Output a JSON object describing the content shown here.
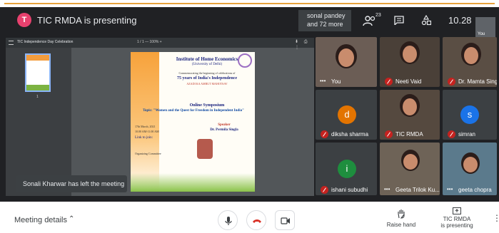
{
  "top_bar": {
    "presenter_initial": "T",
    "presenting_title": "TIC RMDA is presenting",
    "viewers_line1": "sonal pandey",
    "viewers_line2": "and 72 more",
    "people_count": "23",
    "clock": "10.28",
    "self_label": "You"
  },
  "pdf": {
    "title": "TIC Independence Day Celebration",
    "page_nav": "1 / 1   —  100%  +",
    "thumb_number": "1"
  },
  "poster": {
    "institute": "Institute of Home Economics",
    "university": "(University of Delhi)",
    "line_a": "Commemorating the beginning of celebrations of",
    "line_b": "75 years of India's Independence",
    "line_c": "AZADI KA AMRUT MAHOTSAV",
    "line_d": "Online Symposium",
    "topic": "Topic: \"Women and the Quest for Freedom in Independent India\"",
    "speaker_label": "Speaker",
    "speaker_name": "Dr. Permila Singla",
    "date": "17th March, 2021",
    "time": "10.00 AM-11.00 AM",
    "join": "Link to join:",
    "organizing": "Organizing Committee"
  },
  "toast": "Sonali Kharwar has left the meeting",
  "participants": {
    "you": "You",
    "neeti": "Neeti Vaid",
    "mamta": "Dr. Mamta Singh",
    "diksha": "diksha sharma",
    "diksha_initial": "d",
    "tic": "TIC RMDA",
    "simran": "simran",
    "simran_initial": "s",
    "ishani": "ishani subudhi",
    "ishani_initial": "i",
    "geeta_k": "Geeta Trilok Ku...",
    "geeta_c": "geeta chopra"
  },
  "bottom_bar": {
    "meeting_details": "Meeting details",
    "raise_hand": "Raise hand",
    "present_line1": "TIC RMDA",
    "present_line2": "is presenting"
  },
  "colors": {
    "background": "#202124",
    "mute_red": "#c5221f",
    "diksha_avatar": "#e37400",
    "simran_avatar": "#1a73e8",
    "ishani_avatar": "#1e8e3e"
  }
}
